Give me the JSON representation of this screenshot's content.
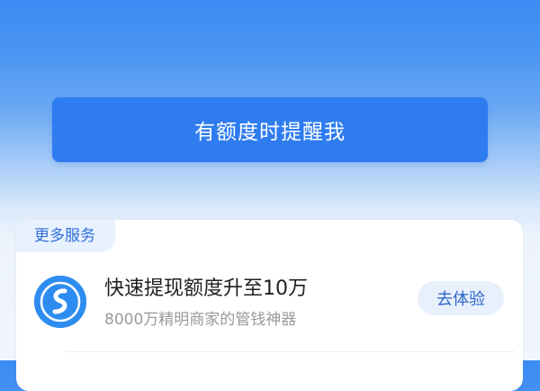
{
  "remind": {
    "label": "有额度时提醒我"
  },
  "more_services": {
    "tag": "更多服务",
    "items": [
      {
        "icon": "app-logo-icon",
        "title": "快速提现额度升至10万",
        "subtitle": "8000万精明商家的管钱神器",
        "action_label": "去体验"
      }
    ]
  },
  "colors": {
    "primary_blue": "#2e7cf0",
    "tag_text": "#2f6fd8",
    "tag_background": "#e8f1fe",
    "action_background": "#e8f0fc"
  }
}
